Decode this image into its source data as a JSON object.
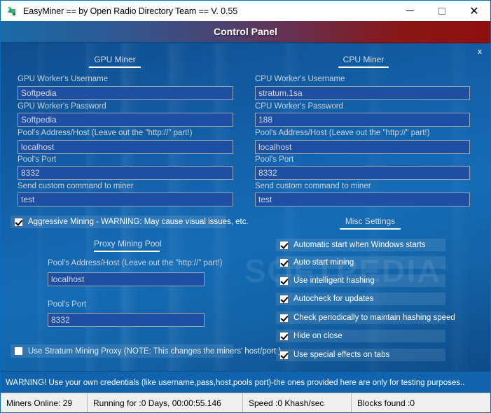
{
  "window": {
    "title": "EasyMiner == by Open Radio Directory Team == V. 0.55",
    "icon": "app-icon",
    "minimize_label": "–",
    "maximize_label": "□",
    "close_label": "✕"
  },
  "header": {
    "title": "Control Panel",
    "gradient_from": "#1a6aa8",
    "gradient_to": "#8f0e0e",
    "panel_close_label": "x"
  },
  "watermark": {
    "text": "SOFTPEDIA",
    "registered": "®"
  },
  "gpu_miner": {
    "section_title": "GPU Miner",
    "fields": [
      {
        "label": "GPU Worker's Username",
        "value": "Softpedia",
        "name": "gpu-username"
      },
      {
        "label": "GPU Worker's Password",
        "value": "Softpedia",
        "name": "gpu-password"
      },
      {
        "label": "Pool's Address/Host (Leave out the \"http://\" part!)",
        "value": "localhost",
        "name": "gpu-pool-host"
      },
      {
        "label": "Pool's Port",
        "value": "8332",
        "name": "gpu-pool-port"
      },
      {
        "label": "Send custom command to miner",
        "value": "test",
        "name": "gpu-custom-command"
      }
    ],
    "aggressive": {
      "label": "Aggressive Mining - WARNING: May cause visual issues, etc.",
      "checked": true
    }
  },
  "cpu_miner": {
    "section_title": "CPU Miner",
    "fields": [
      {
        "label": "CPU Worker's Username",
        "value": "stratum.1sa",
        "name": "cpu-username"
      },
      {
        "label": "CPU Worker's Password",
        "value": "188",
        "name": "cpu-password"
      },
      {
        "label": "Pool's Address/Host (Leave out the \"http://\" part!)",
        "value": "localhost",
        "name": "cpu-pool-host"
      },
      {
        "label": "Pool's Port",
        "value": "8332",
        "name": "cpu-pool-port"
      },
      {
        "label": "Send custom command to miner",
        "value": "test",
        "name": "cpu-custom-command"
      }
    ]
  },
  "proxy_pool": {
    "section_title": "Proxy Mining Pool",
    "fields": [
      {
        "label": "Pool's Address/Host (Leave out the \"http://\" part!)",
        "value": "localhost",
        "name": "proxy-pool-host"
      },
      {
        "label": "Pool's Port",
        "value": "8332",
        "name": "proxy-pool-port"
      }
    ],
    "use_stratum": {
      "label": "Use Stratum Mining Proxy (NOTE: This changes the miners' host/port )",
      "checked": false
    }
  },
  "misc_settings": {
    "section_title": "Misc Settings",
    "options": [
      {
        "label": "Automatic start when Windows starts",
        "checked": true
      },
      {
        "label": "Auto start mining",
        "checked": true
      },
      {
        "label": "Use intelligent hashing",
        "checked": true
      },
      {
        "label": "Autocheck for updates",
        "checked": true
      },
      {
        "label": "Check periodically to maintain hashing speed",
        "checked": true
      },
      {
        "label": "Hide on close",
        "checked": true
      },
      {
        "label": "Use special effects on tabs",
        "checked": true
      }
    ]
  },
  "warning": {
    "text": "WARNING! Use your own credentials (like username,pass,host,pools port)-the ones provided here are only for testing purposes.."
  },
  "status_bar": {
    "miners_online": "Miners Online: 29",
    "running_for": "Running for :0 Days, 00:00:55.146",
    "speed": "Speed :0 Khash/sec",
    "blocks_found": "Blocks found :0"
  }
}
